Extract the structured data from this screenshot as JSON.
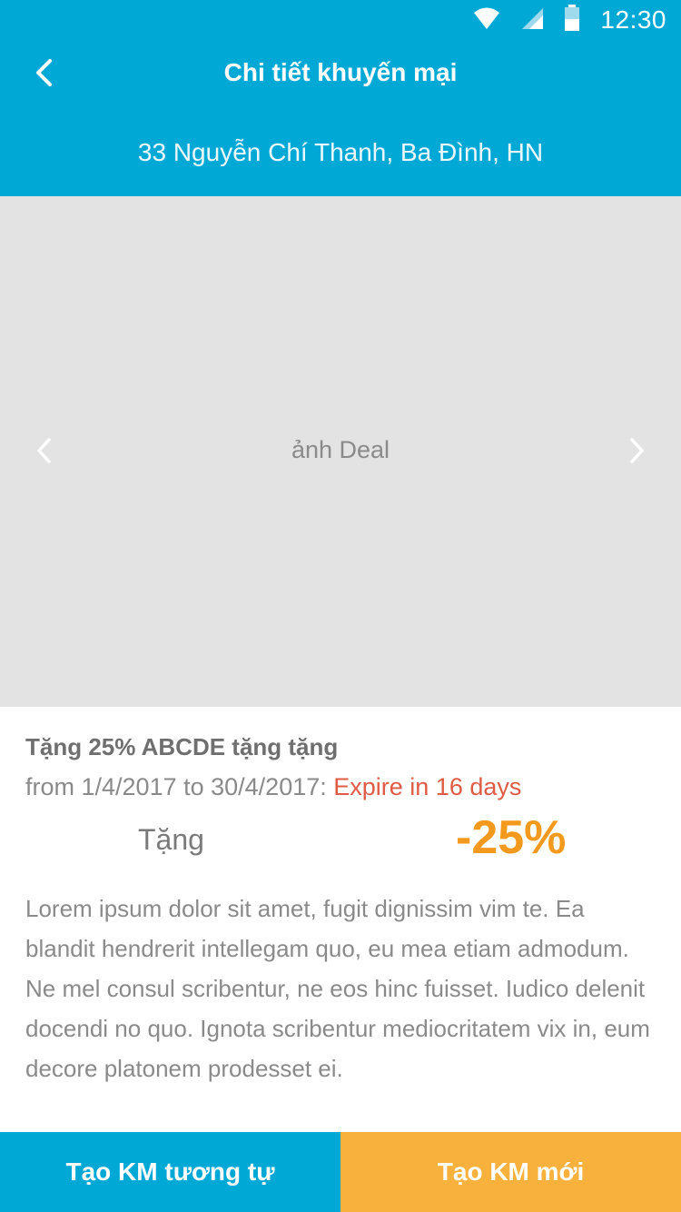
{
  "status_bar": {
    "time": "12:30",
    "icons": [
      "wifi-icon",
      "cell-signal-icon",
      "battery-icon"
    ]
  },
  "header": {
    "back_icon": "chevron-left-icon",
    "title": "Chi tiết khuyến mại",
    "address": "33 Nguyễn Chí Thanh, Ba Đình, HN"
  },
  "carousel": {
    "placeholder": "ảnh Deal",
    "prev_icon": "chevron-left-icon",
    "next_icon": "chevron-right-icon"
  },
  "deal": {
    "title": "Tặng 25% ABCDE tặng tặng",
    "date_range": "from 1/4/2017 to 30/4/2017: ",
    "expire_text": "Expire in 16 days",
    "discount_label": "Tặng",
    "discount_value": "-25%",
    "description": "Lorem ipsum dolor sit amet, fugit dignissim vim te. Ea blandit hendrerit intellegam quo, eu mea etiam admodum. Ne mel consul scribentur, ne eos hinc fuisset. Iudico delenit docendi no quo. Ignota scribentur mediocritatem vix in, eum decore platonem prodesset ei."
  },
  "actions": {
    "similar_label": "Tạo KM tương tự",
    "new_label": "Tạo KM mới"
  },
  "colors": {
    "primary": "#00a8d6",
    "accent_orange": "#f8b13c",
    "discount": "#f39a1e",
    "expire": "#e05b45",
    "carousel_bg": "#e3e3e3"
  }
}
